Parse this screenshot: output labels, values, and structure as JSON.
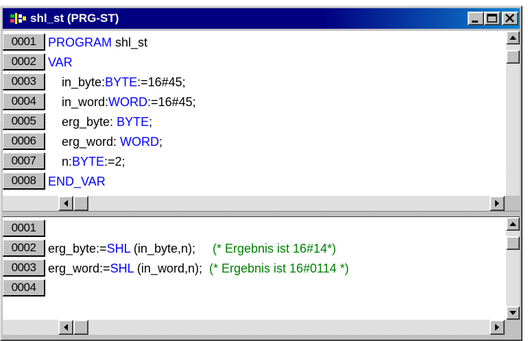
{
  "window": {
    "title": "shl_st (PRG-ST)",
    "icons": {
      "app": "poe-program-icon",
      "minimize": "minimize-icon",
      "maximize": "maximize-icon",
      "close": "close-icon"
    }
  },
  "declaration": {
    "lines": [
      {
        "num": "0001",
        "parts": [
          {
            "t": "PROGRAM",
            "c": "kw"
          },
          {
            "t": " shl_st",
            "c": ""
          }
        ]
      },
      {
        "num": "0002",
        "parts": [
          {
            "t": "VAR",
            "c": "kw"
          }
        ]
      },
      {
        "num": "0003",
        "parts": [
          {
            "t": "    in_byte:",
            "c": ""
          },
          {
            "t": "BYTE",
            "c": "kw"
          },
          {
            "t": ":=16#45;",
            "c": ""
          }
        ]
      },
      {
        "num": "0004",
        "parts": [
          {
            "t": "    in_word:",
            "c": ""
          },
          {
            "t": "WORD",
            "c": "kw"
          },
          {
            "t": ":=16#45;",
            "c": ""
          }
        ]
      },
      {
        "num": "0005",
        "parts": [
          {
            "t": "    erg_byte: ",
            "c": ""
          },
          {
            "t": "BYTE",
            "c": "kw"
          },
          {
            "t": ";",
            "c": ""
          }
        ]
      },
      {
        "num": "0006",
        "parts": [
          {
            "t": "    erg_word: ",
            "c": ""
          },
          {
            "t": "WORD",
            "c": "kw"
          },
          {
            "t": ";",
            "c": ""
          }
        ]
      },
      {
        "num": "0007",
        "parts": [
          {
            "t": "    n:",
            "c": ""
          },
          {
            "t": "BYTE",
            "c": "kw"
          },
          {
            "t": ":=2;",
            "c": ""
          }
        ]
      },
      {
        "num": "0008",
        "parts": [
          {
            "t": "END_VAR",
            "c": "kw"
          }
        ]
      }
    ]
  },
  "body": {
    "lines": [
      {
        "num": "0001",
        "parts": []
      },
      {
        "num": "0002",
        "parts": [
          {
            "t": "erg_byte:=",
            "c": ""
          },
          {
            "t": "SHL",
            "c": "kw"
          },
          {
            "t": " (in_byte,n);     ",
            "c": ""
          },
          {
            "t": "(* Ergebnis ist 16#14*)",
            "c": "cm"
          }
        ]
      },
      {
        "num": "0003",
        "parts": [
          {
            "t": "erg_word:=",
            "c": ""
          },
          {
            "t": "SHL",
            "c": "kw"
          },
          {
            "t": " (in_word,n);  ",
            "c": ""
          },
          {
            "t": "(* Ergebnis ist 16#0114 *)",
            "c": "cm"
          }
        ]
      },
      {
        "num": "0004",
        "parts": []
      }
    ]
  },
  "colors": {
    "keyword": "#0000ff",
    "comment": "#008000",
    "titlebar": "#000080"
  }
}
